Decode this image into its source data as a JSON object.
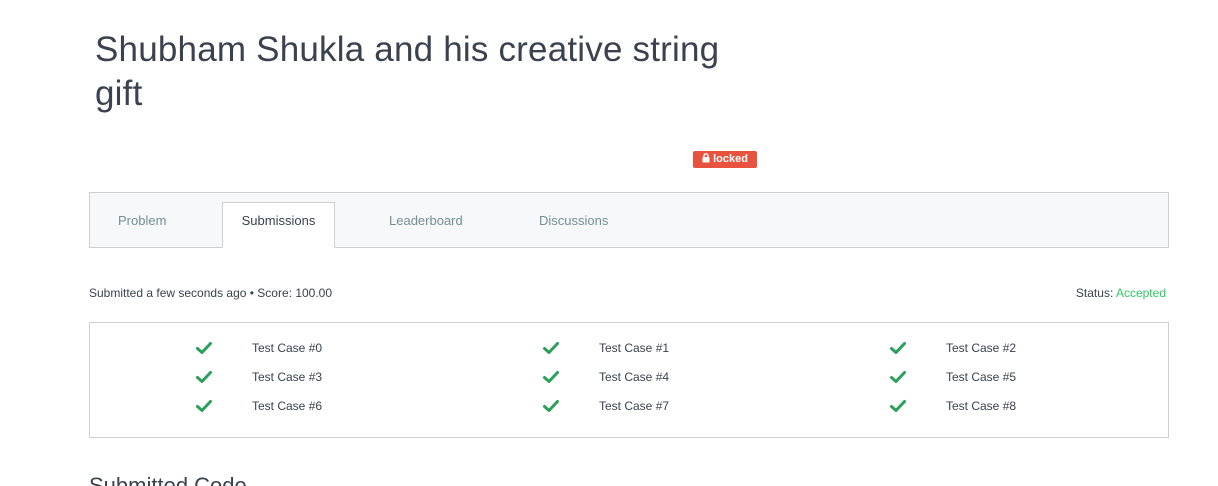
{
  "challenge": {
    "title": "Shubham Shukla and his creative string gift",
    "badge": {
      "label": "locked",
      "icon": "lock-icon",
      "color": "#e8533f"
    }
  },
  "tabs": [
    {
      "label": "Problem",
      "active": false
    },
    {
      "label": "Submissions",
      "active": true
    },
    {
      "label": "Leaderboard",
      "active": false
    },
    {
      "label": "Discussions",
      "active": false
    }
  ],
  "submission": {
    "summary": "Submitted a few seconds ago • Score: 100.00",
    "status_label": "Status:",
    "status_value": "Accepted",
    "status_color": "#2ec866"
  },
  "test_cases": [
    {
      "label": "Test Case #0",
      "passed": true,
      "icon": "check-icon"
    },
    {
      "label": "Test Case #1",
      "passed": true,
      "icon": "check-icon"
    },
    {
      "label": "Test Case #2",
      "passed": true,
      "icon": "check-icon"
    },
    {
      "label": "Test Case #3",
      "passed": true,
      "icon": "check-icon"
    },
    {
      "label": "Test Case #4",
      "passed": true,
      "icon": "check-icon"
    },
    {
      "label": "Test Case #5",
      "passed": true,
      "icon": "check-icon"
    },
    {
      "label": "Test Case #6",
      "passed": true,
      "icon": "check-icon"
    },
    {
      "label": "Test Case #7",
      "passed": true,
      "icon": "check-icon"
    },
    {
      "label": "Test Case #8",
      "passed": true,
      "icon": "check-icon"
    }
  ],
  "code_section": {
    "heading": "Submitted Code"
  }
}
